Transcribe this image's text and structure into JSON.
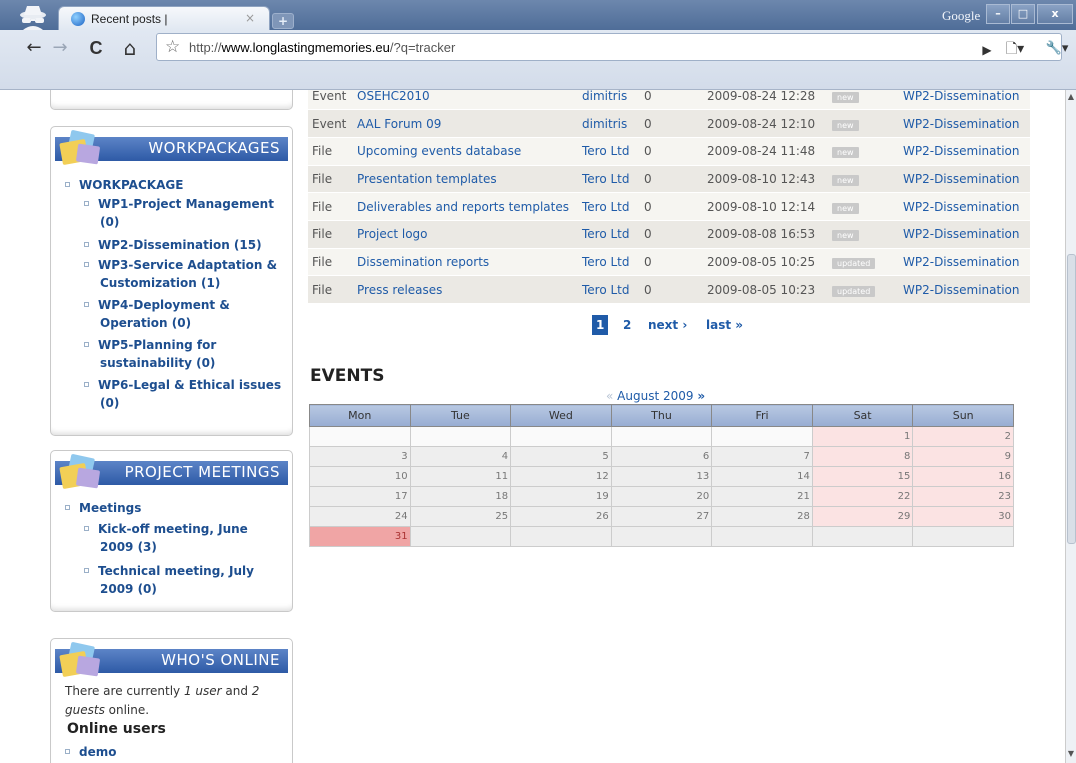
{
  "browser": {
    "tab_title": "Recent posts |",
    "tab_close": "×",
    "new_tab": "+",
    "google_label": "Google",
    "window_buttons": {
      "minimize": "–",
      "maximize": "□",
      "close": "x"
    },
    "nav": {
      "back": "←",
      "forward": "→",
      "reload": "C",
      "home": "⌂",
      "go": "▶",
      "page_menu": "🗋▾",
      "tools_menu": "🔧▾"
    },
    "url_prefix": "http://",
    "url_domain": "www.longlastingmemories.eu",
    "url_path": "/?q=tracker",
    "star": "☆"
  },
  "sidebar": {
    "workpackages": {
      "title": "WORKPACKAGES",
      "root": "WORKPACKAGE",
      "items": [
        {
          "line1": "WP1-Project Management",
          "line2": "(0)"
        },
        {
          "line1": "WP2-Dissemination (15)",
          "line2": ""
        },
        {
          "line1": "WP3-Service Adaptation &",
          "line2": "Customization (1)"
        },
        {
          "line1": "WP4-Deployment &",
          "line2": "Operation (0)"
        },
        {
          "line1": "WP5-Planning for",
          "line2": "sustainability (0)"
        },
        {
          "line1": "WP6-Legal & Ethical issues",
          "line2": "(0)"
        }
      ]
    },
    "meetings": {
      "title": "PROJECT MEETINGS",
      "root": "Meetings",
      "items": [
        {
          "line1": "Kick-off meeting, June",
          "line2": "2009 (3)"
        },
        {
          "line1": "Technical meeting, July",
          "line2": "2009 (0)"
        }
      ]
    },
    "whos_online": {
      "title": "WHO'S ONLINE",
      "text_a": "There are currently ",
      "users": "1 user",
      "text_b": " and ",
      "guests_num": "2",
      "guests": "guests",
      "text_c": " online.",
      "online_heading": "Online users",
      "user": "demo"
    }
  },
  "tracker": {
    "rows": [
      {
        "type": "Event",
        "post": "OSEHC2010",
        "author": "dimitris",
        "replies": "0",
        "updated": "2009-08-24 12:28",
        "mark": "new",
        "group": "WP2-Dissemination"
      },
      {
        "type": "Event",
        "post": "AAL Forum 09",
        "author": "dimitris",
        "replies": "0",
        "updated": "2009-08-24 12:10",
        "mark": "new",
        "group": "WP2-Dissemination"
      },
      {
        "type": "File",
        "post": "Upcoming events database",
        "author": "Tero Ltd",
        "replies": "0",
        "updated": "2009-08-24 11:48",
        "mark": "new",
        "group": "WP2-Dissemination"
      },
      {
        "type": "File",
        "post": "Presentation templates",
        "author": "Tero Ltd",
        "replies": "0",
        "updated": "2009-08-10 12:43",
        "mark": "new",
        "group": "WP2-Dissemination"
      },
      {
        "type": "File",
        "post": "Deliverables and reports templates",
        "author": "Tero Ltd",
        "replies": "0",
        "updated": "2009-08-10 12:14",
        "mark": "new",
        "group": "WP2-Dissemination"
      },
      {
        "type": "File",
        "post": "Project logo",
        "author": "Tero Ltd",
        "replies": "0",
        "updated": "2009-08-08 16:53",
        "mark": "new",
        "group": "WP2-Dissemination"
      },
      {
        "type": "File",
        "post": "Dissemination reports",
        "author": "Tero Ltd",
        "replies": "0",
        "updated": "2009-08-05 10:25",
        "mark": "updated",
        "group": "WP2-Dissemination"
      },
      {
        "type": "File",
        "post": "Press releases",
        "author": "Tero Ltd",
        "replies": "0",
        "updated": "2009-08-05 10:23",
        "mark": "updated",
        "group": "WP2-Dissemination"
      }
    ],
    "pager": {
      "current": "1",
      "page2": "2",
      "next": "next ›",
      "last": "last »"
    }
  },
  "events": {
    "heading": "EVENTS",
    "prev_arrow": "«",
    "month": "August 2009",
    "next_arrow": "»",
    "weekdays": [
      "Mon",
      "Tue",
      "Wed",
      "Thu",
      "Fri",
      "Sat",
      "Sun"
    ],
    "weeks": [
      [
        "",
        "",
        "",
        "",
        "",
        "1",
        "2"
      ],
      [
        "3",
        "4",
        "5",
        "6",
        "7",
        "8",
        "9"
      ],
      [
        "10",
        "11",
        "12",
        "13",
        "14",
        "15",
        "16"
      ],
      [
        "17",
        "18",
        "19",
        "20",
        "21",
        "22",
        "23"
      ],
      [
        "24",
        "25",
        "26",
        "27",
        "28",
        "29",
        "30"
      ],
      [
        "31",
        "",
        "",
        "",
        "",
        "",
        ""
      ]
    ],
    "today": "31"
  },
  "colors": {
    "link": "#1f5ba8",
    "header_blue": "#2e5aa6",
    "weekend": "#fbe3e3",
    "today": "#f0a5a5"
  }
}
